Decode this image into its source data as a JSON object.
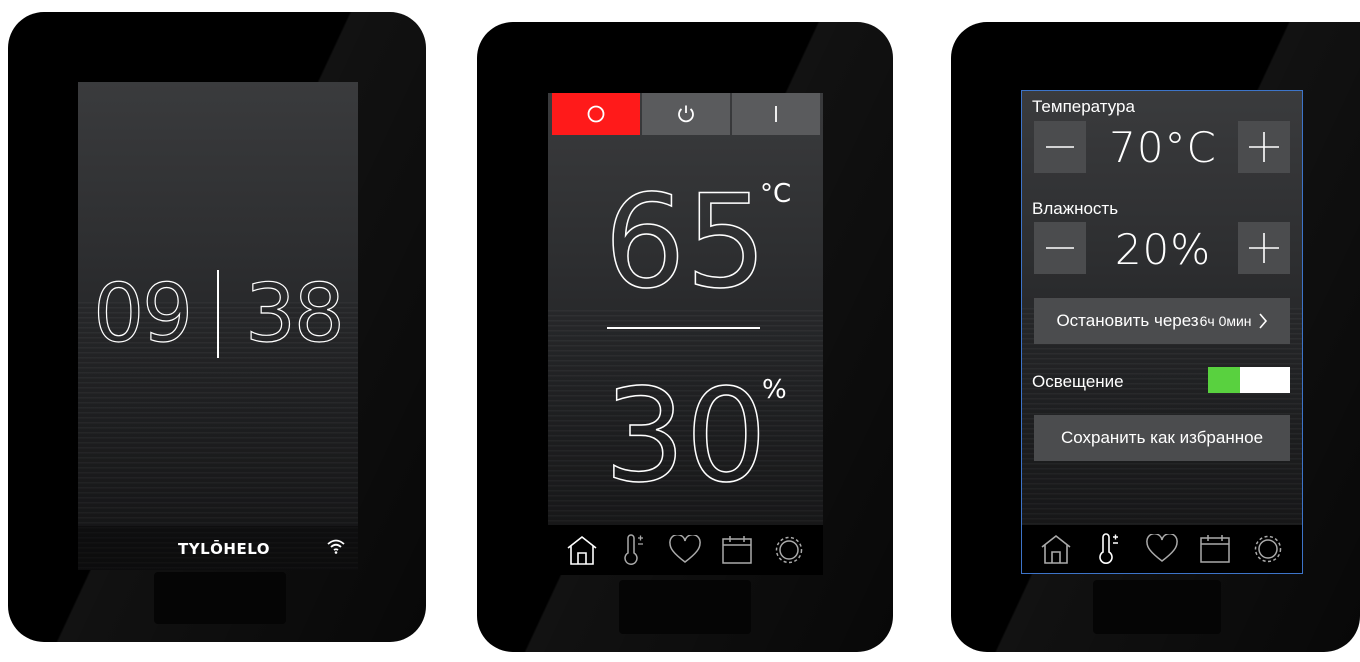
{
  "panel1": {
    "clock": {
      "hours": "09",
      "minutes": "38"
    },
    "logo": "TYLŌHELO",
    "wifi_icon": "wifi-icon"
  },
  "panel2": {
    "mode_buttons": [
      {
        "icon": "off-circle-icon",
        "active": true
      },
      {
        "icon": "power-icon",
        "active": false
      },
      {
        "icon": "on-bar-icon",
        "active": false
      }
    ],
    "temperature": {
      "value": "65",
      "unit": "°C"
    },
    "humidity": {
      "value": "30",
      "unit": "%"
    },
    "nav": [
      "home-icon",
      "thermometer-icon",
      "heart-icon",
      "calendar-icon",
      "settings-icon"
    ],
    "nav_active": "home-icon"
  },
  "panel3": {
    "temperature_label": "Температура",
    "temperature_value": "70°C",
    "humidity_label": "Влажность",
    "humidity_value": "20%",
    "stop_after_label": "Остановить через",
    "stop_after_value": "6ч 0мин",
    "lighting_label": "Освещение",
    "lighting_on": true,
    "save_favorite_label": "Сохранить как избранное",
    "nav": [
      "home-icon",
      "thermometer-icon",
      "heart-icon",
      "calendar-icon",
      "settings-icon"
    ],
    "nav_active": "thermometer-icon"
  },
  "colors": {
    "active_red": "#ff1a1a",
    "toggle_green": "#59d13f",
    "button_gray": "#4b4c4e",
    "selection_blue": "#3d74c9"
  }
}
